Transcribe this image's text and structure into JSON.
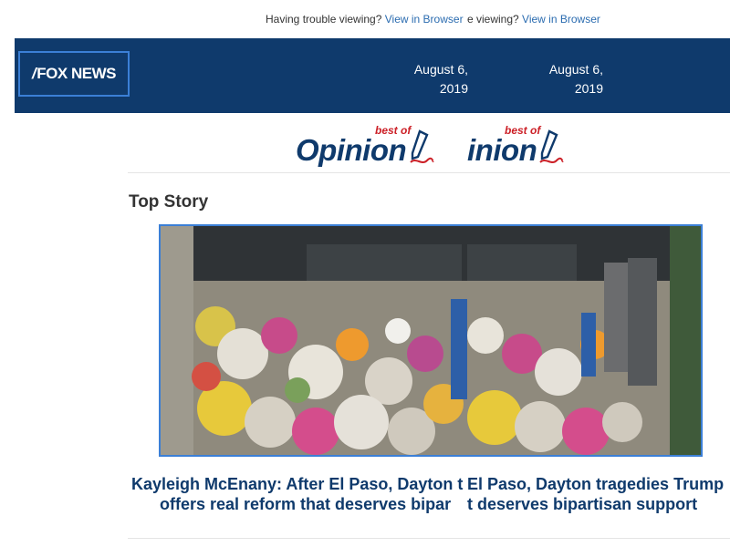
{
  "trouble_bar": {
    "text": "Having trouble viewing?",
    "link": "View in Browser",
    "dup_text": "e viewing?",
    "dup_link": "View in Browser"
  },
  "header": {
    "logo_text": "FOX NEWS",
    "logo_slash": "/",
    "date": "August 6, 2019",
    "date_dup": "August 6, 2019"
  },
  "opinion_banner": {
    "word": "Opinion",
    "word_dup": "inion",
    "tag": "best of",
    "tag_dup": "best of"
  },
  "section": {
    "title": "Top Story"
  },
  "story": {
    "headline_line1_left": "Kayleigh McEnany: After El Paso, Dayton t",
    "headline_line1_right": "El Paso, Dayton tragedies Trump",
    "headline_line2_left": "offers real reform that deserves bipar",
    "headline_line2_right": "t deserves bipartisan support"
  },
  "colors": {
    "header_bg": "#0f3a6c",
    "link": "#2b6cb0",
    "accent_red": "#cc2027",
    "frame_border": "#3b7fd6"
  }
}
